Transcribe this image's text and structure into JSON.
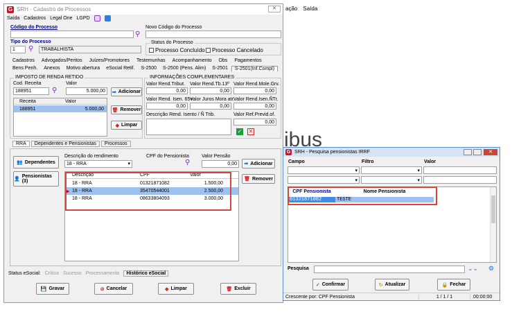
{
  "background": {
    "menu": [
      "ação",
      "Saída"
    ],
    "watermark": "ibus"
  },
  "main": {
    "title": "SRH - Cadastro de Processos",
    "menu": [
      "Saída",
      "Cadastros",
      "Legal One",
      "LGPD"
    ],
    "codigo_label": "Código do Processo",
    "novo_codigo_label": "Novo Código do Processo",
    "tipo_label": "Tipo do Processo",
    "tipo_code": "1",
    "tipo_value": "TRABALHISTA",
    "status_label": "Status do Processo",
    "status_opts": [
      "Processo Concluído",
      "Processo Cancelado"
    ],
    "tabs_row1": [
      "Cadastros",
      "Advogados/Peritos",
      "Juízes/Promotores",
      "Testemunhas",
      "Acompanhamento",
      "Obs",
      "Pagamentos"
    ],
    "tabs_row2": [
      "Bens Penh.",
      "Anexos",
      "Motivo abertura",
      "eSocial Retif.",
      "S-2500",
      "S-2500 (Pens. Alim)",
      "S-2501",
      "S-2501(Inf.Compl)"
    ],
    "ir": {
      "title": "IMPOSTO DE RENDA RETIDO",
      "cod_label": "Cod. Receita",
      "cod_value": "188951",
      "valor_label": "Valor",
      "valor_value": "5.000,00",
      "cols": [
        "Receita",
        "Valor"
      ],
      "rows": [
        [
          "188951",
          "5.000,00"
        ]
      ],
      "btn_add": "Adicionar",
      "btn_remove": "Remover",
      "btn_clear": "Limpar"
    },
    "info": {
      "title": "INFORMAÇÕES COMPLEMENTARES",
      "row1": [
        [
          "Valor Rend.Tribut.",
          "0,00"
        ],
        [
          "Valor Rend.Tb.13º",
          "0,00"
        ],
        [
          "Valor Rend.Mole.Grv.",
          "0,00"
        ]
      ],
      "row2": [
        [
          "Valor Rend. Isen. 65+",
          "0,00"
        ],
        [
          "Valor Juros Mora atr.",
          "0,00"
        ],
        [
          "Valor Rend.Isen.ÑTr.",
          "0,00"
        ]
      ],
      "desc_label": "Descrição Rend. Isento / Ñ Trib.",
      "ref_label": "Valor Ref.Previd.of.",
      "ref_value": "0,00"
    },
    "subtabs": [
      "RRA",
      "Dependentes e Pensionistas",
      "Processos"
    ],
    "side_buttons": [
      "Dependentes",
      "Pensionistas (3)"
    ],
    "rend": {
      "desc_label": "Descrição do rendimento",
      "desc_value": "18 - RRA",
      "cpf_label": "CPF do Pensionista",
      "valor_label": "Valor Pensão",
      "valor_value": "0,00",
      "btn_add": "Adicionar",
      "btn_remove": "Remover",
      "cols": [
        "Descrição",
        "CPF",
        "Valor"
      ],
      "rows": [
        [
          "18 - RRA",
          "01321871082",
          "1.500,00"
        ],
        [
          "18 - RRA",
          "35470544001",
          "2.500,00"
        ],
        [
          "18 - RRA",
          "08633804093",
          "3.000,00"
        ]
      ]
    },
    "status_bar": {
      "label": "Status eSocial:",
      "items": [
        "Crítica",
        "Sucesso",
        "Processamento"
      ],
      "historico": "Histórico eSocial"
    },
    "actions": [
      "Gravar",
      "Cancelar",
      "Limpar",
      "Excluir"
    ]
  },
  "popup": {
    "title": "SRH - Pesquisa pensionistas IRRF",
    "filter_labels": [
      "Campo",
      "Filtro",
      "Valor"
    ],
    "cols": [
      "CPF Pensionista",
      "Nome Pensionista"
    ],
    "rows": [
      [
        "01321871082",
        "TESTE"
      ]
    ],
    "search_label": "Pesquisa",
    "buttons": [
      "Confirmar",
      "Atualizar",
      "Fechar"
    ],
    "status_left": "Crescente por: CPF Pensionista",
    "status_mid": "1 / 1 / 1",
    "status_right": "00:00:00"
  },
  "colors": {
    "accent_red": "#d8433e",
    "selection": "#9ec1f0",
    "popup_selection": "#3d8ee8"
  }
}
